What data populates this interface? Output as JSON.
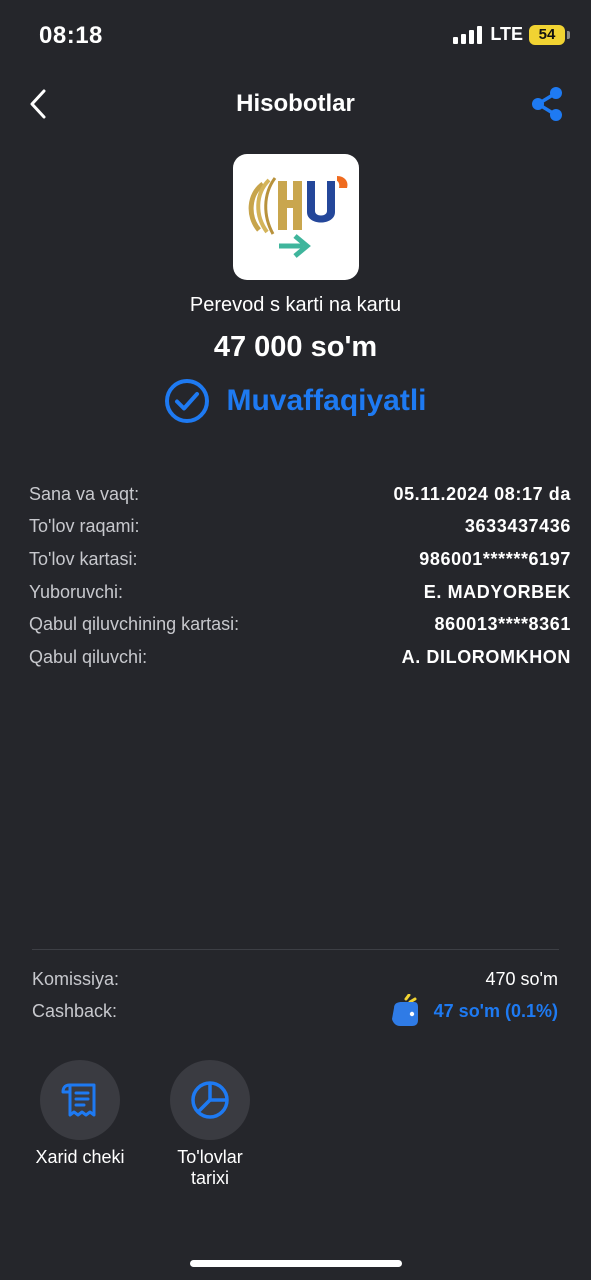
{
  "status_bar": {
    "time": "08:18",
    "network": "LTE",
    "battery": "54"
  },
  "nav": {
    "title": "Hisobotlar"
  },
  "transaction": {
    "type": "Perevod s karti na kartu",
    "amount": "47 000 so'm",
    "status": "Muvaffaqiyatli"
  },
  "details": [
    {
      "label": "Sana va vaqt:",
      "value": "05.11.2024 08:17 da"
    },
    {
      "label": "To'lov raqami:",
      "value": "3633437436"
    },
    {
      "label": "To'lov kartasi:",
      "value": "986001******6197"
    },
    {
      "label": "Yuboruvchi:",
      "value": "E. MADYORBEK"
    },
    {
      "label": "Qabul qiluvchining kartasi:",
      "value": "860013****8361"
    },
    {
      "label": "Qabul qiluvchi:",
      "value": "A. DILOROMKHON"
    }
  ],
  "fees": {
    "commission_label": "Komissiya:",
    "commission_value": "470 so'm",
    "cashback_label": "Cashback:",
    "cashback_value": "47 so'm (0.1%)"
  },
  "actions": {
    "receipt_label": "Xarid cheki",
    "history_label": "To'lovlar\ntarixi"
  },
  "colors": {
    "background": "#25262b",
    "accent": "#1e7af2",
    "battery": "#f1d332"
  },
  "icons": {
    "back": "chevron-left-icon",
    "share": "share-icon",
    "status": "check-circle-icon",
    "cashback": "wallet-icon",
    "receipt": "receipt-icon",
    "history": "pie-chart-icon"
  }
}
